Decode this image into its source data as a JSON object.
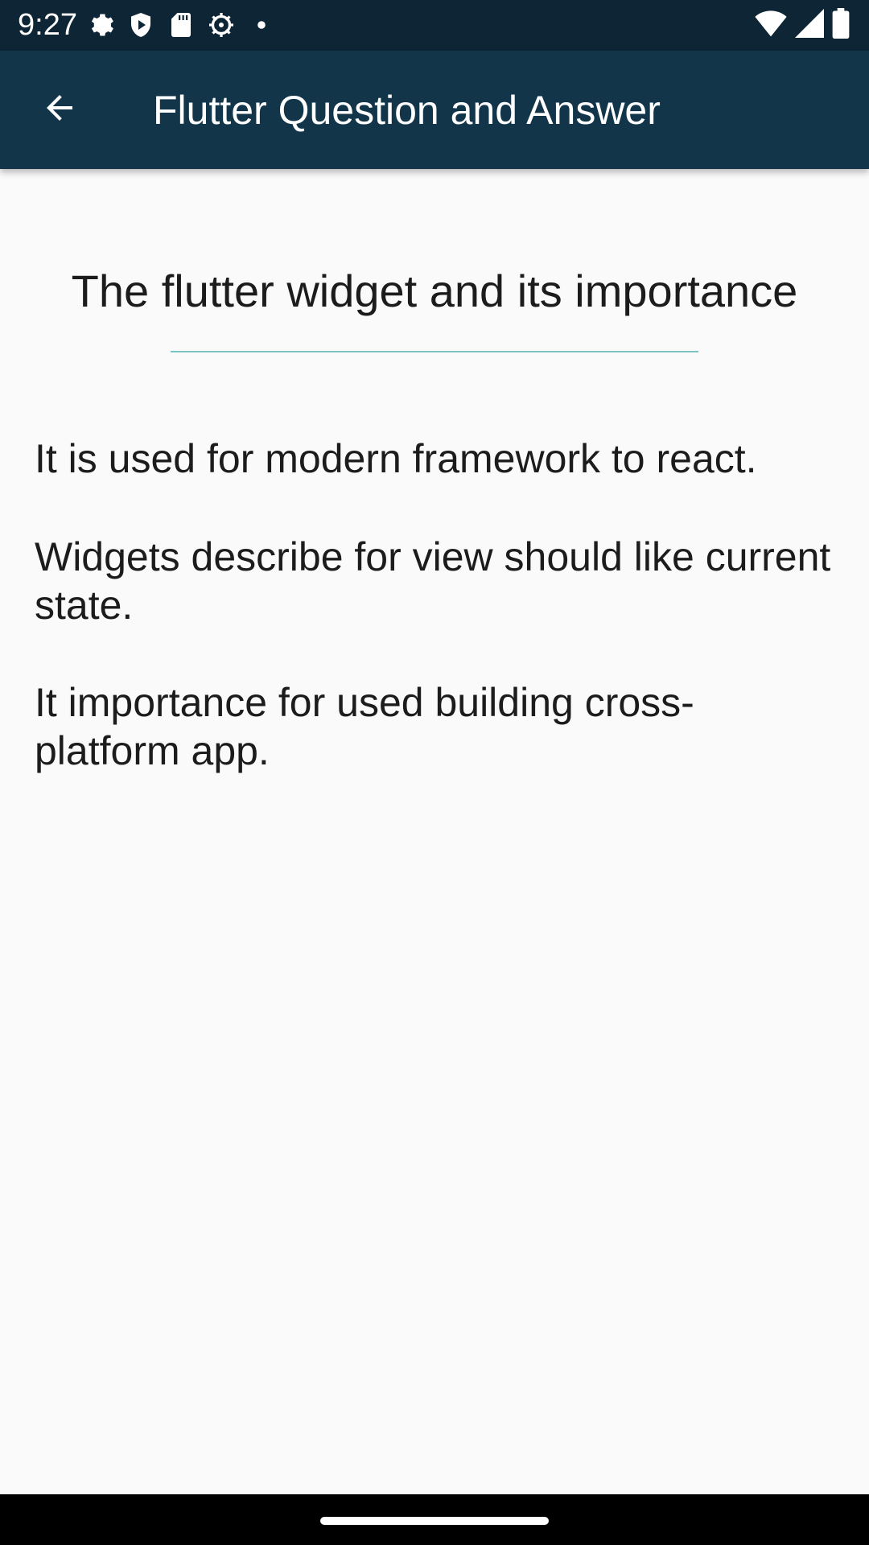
{
  "status_bar": {
    "time": "9:27",
    "left_icons": [
      "settings-gear-icon",
      "shield-icon",
      "sd-card-icon",
      "debug-gear-icon",
      "notification-dot-icon"
    ],
    "right_icons": [
      "wifi-icon",
      "signal-icon",
      "battery-icon"
    ]
  },
  "app_bar": {
    "back_icon": "arrow-back-icon",
    "title": "Flutter Question and Answer",
    "background": "#12354a"
  },
  "question": {
    "title": "The flutter widget and its importance"
  },
  "answers": [
    "It is used for modern framework to react.",
    "Widgets describe for view should like current state.",
    "It importance for used building cross-platform app."
  ],
  "colors": {
    "status_bar": "#0d2535",
    "app_bar": "#12354a",
    "divider": "#7cc4c4",
    "background": "#fafafa",
    "text": "#1c1c1c"
  }
}
